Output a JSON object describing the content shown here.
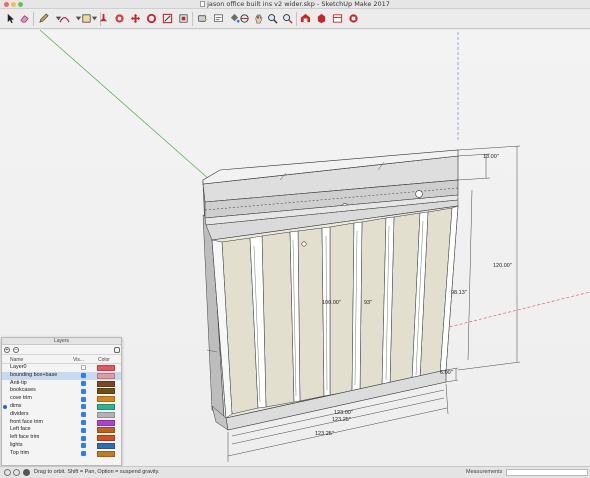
{
  "window": {
    "title": "jason office built ins v2 wider.skp - SketchUp Make 2017"
  },
  "toolbar": {
    "tools": [
      {
        "name": "select-tool-icon"
      },
      {
        "name": "eraser-tool-icon"
      },
      {
        "name": "pencil-tool-icon"
      },
      {
        "name": "arc-tool-icon"
      },
      {
        "name": "shapes-tool-icon"
      },
      {
        "name": "push-pull-tool-icon"
      },
      {
        "name": "follow-me-tool-icon"
      },
      {
        "name": "move-tool-icon"
      },
      {
        "name": "rotate-tool-icon"
      },
      {
        "name": "scale-tool-icon"
      },
      {
        "name": "offset-tool-icon"
      },
      {
        "name": "tape-measure-tool-icon"
      },
      {
        "name": "text-tool-icon"
      },
      {
        "name": "paint-bucket-tool-icon"
      },
      {
        "name": "orbit-tool-icon"
      },
      {
        "name": "pan-tool-icon"
      },
      {
        "name": "zoom-tool-icon"
      },
      {
        "name": "zoom-extents-tool-icon"
      },
      {
        "name": "warehouse-icon"
      },
      {
        "name": "extension-warehouse-icon"
      },
      {
        "name": "layout-icon"
      },
      {
        "name": "extension-manager-icon"
      }
    ]
  },
  "model": {
    "dimensions": {
      "top_depth": "13.00\"",
      "total_height": "120.00\"",
      "upper_height": "98.13\"",
      "base_height": "6.00\"",
      "opening_height": "100.00\"",
      "interior_height": "93\"",
      "inner_width": "123.00\"",
      "mid_width": "123.25\"",
      "outer_width": "123.25\""
    }
  },
  "layers_panel": {
    "title": "Layers",
    "add_label": "+",
    "remove_label": "−",
    "col_name": "Name",
    "col_visible": "Vis...",
    "col_color": "Color",
    "layers": [
      {
        "name": "Layer0",
        "visible": false,
        "color": "#e8545f",
        "active": false,
        "selected": false
      },
      {
        "name": "bounding box+base",
        "visible": true,
        "color": "#e29aa0",
        "active": false,
        "selected": true
      },
      {
        "name": "Anti-tip",
        "visible": true,
        "color": "#7a4a1e",
        "active": false,
        "selected": false
      },
      {
        "name": "bookcases",
        "visible": true,
        "color": "#6b5112",
        "active": false,
        "selected": false
      },
      {
        "name": "cove trim",
        "visible": true,
        "color": "#d6861f",
        "active": false,
        "selected": false
      },
      {
        "name": "dims",
        "visible": true,
        "color": "#27b58d",
        "active": true,
        "selected": false
      },
      {
        "name": "dividers",
        "visible": true,
        "color": "#b3b3b3",
        "active": false,
        "selected": false
      },
      {
        "name": "front face trim",
        "visible": true,
        "color": "#b13fd6",
        "active": false,
        "selected": false
      },
      {
        "name": "Left face",
        "visible": true,
        "color": "#c0621a",
        "active": false,
        "selected": false
      },
      {
        "name": "left face trim",
        "visible": true,
        "color": "#d84d18",
        "active": false,
        "selected": false
      },
      {
        "name": "lights",
        "visible": true,
        "color": "#2b6fb5",
        "active": false,
        "selected": false
      },
      {
        "name": "Top trim",
        "visible": true,
        "color": "#c47a1a",
        "active": false,
        "selected": false
      }
    ]
  },
  "statusbar": {
    "hint": "Drag to orbit. Shift = Pan, Option = suspend gravity.",
    "measurements_label": "Measurements",
    "measurements_value": ""
  }
}
